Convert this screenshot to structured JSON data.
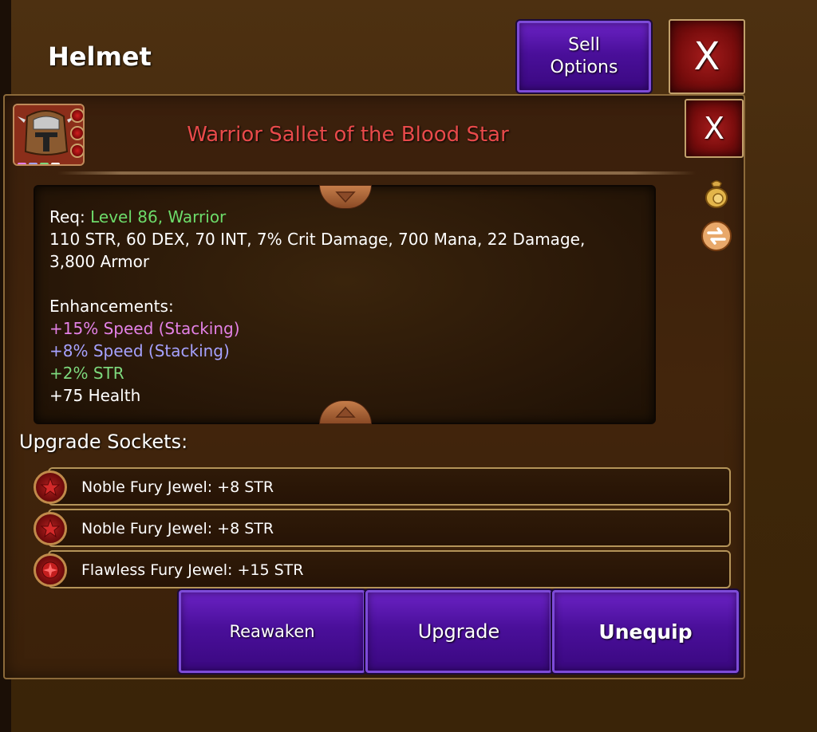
{
  "header": {
    "title": "Helmet",
    "sell_button": "Sell\nOptions",
    "close_label": "X"
  },
  "item": {
    "name": "Warrior Sallet of the Blood Star",
    "close_label": "X",
    "title_color": "#e84a4a",
    "rarity_squares": [
      "#e37de8",
      "#a6a2ff",
      "#7dd87d",
      "#ffffff"
    ]
  },
  "stats": {
    "req_prefix": "Req: ",
    "req_level": "Level 86",
    "req_sep": ", ",
    "req_class": "Warrior",
    "base_stats_line1": "110 STR, 60 DEX, 70 INT, 7% Crit Damage, 700 Mana, 22 Damage,",
    "base_stats_line2": "3,800 Armor",
    "enhancements_label": "Enhancements:",
    "enhancements": [
      {
        "text": "+15% Speed (Stacking)",
        "color": "#e381e6"
      },
      {
        "text": "+8% Speed (Stacking)",
        "color": "#a6a2ff"
      },
      {
        "text": "+2% STR",
        "color": "#7dd87d"
      },
      {
        "text": "+75 Health",
        "color": "#ffffff"
      }
    ]
  },
  "sockets": {
    "label": "Upgrade Sockets:",
    "rows": [
      {
        "text": "Noble Fury Jewel: +8 STR",
        "icon": "star-jewel-icon"
      },
      {
        "text": "Noble Fury Jewel: +8 STR",
        "icon": "star-jewel-icon"
      },
      {
        "text": "Flawless Fury Jewel: +15 STR",
        "icon": "flawless-jewel-icon"
      }
    ]
  },
  "actions": {
    "reawaken": "Reawaken",
    "upgrade": "Upgrade",
    "unequip": "Unequip"
  },
  "side_icons": [
    "gold-bag-icon",
    "swap-icon"
  ]
}
